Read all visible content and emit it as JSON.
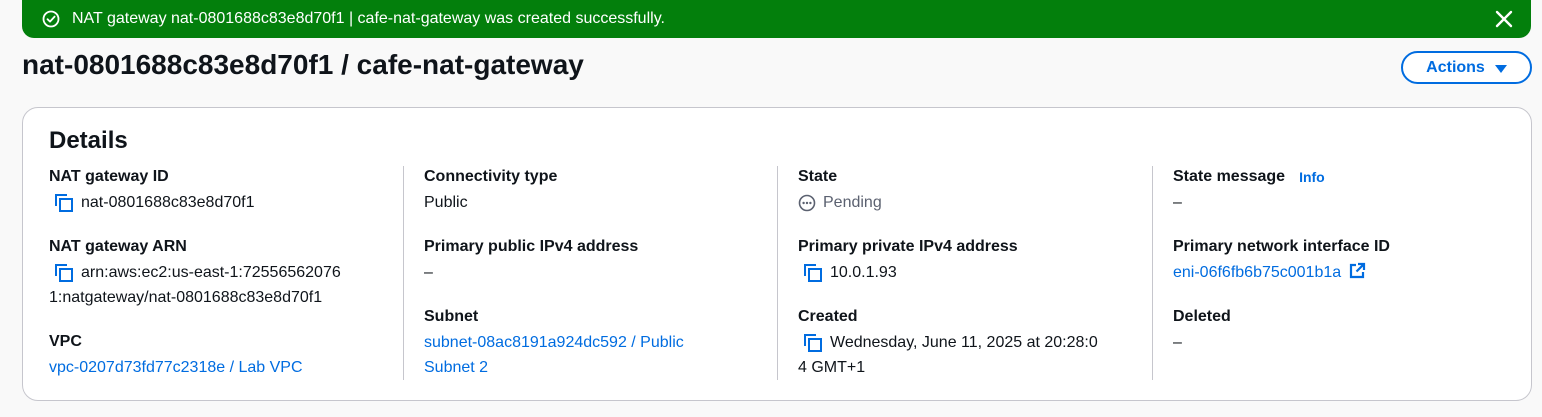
{
  "flash": {
    "message": "NAT gateway nat-0801688c83e8d70f1 | cafe-nat-gateway was created successfully.",
    "icon": "check-circle-icon",
    "dismiss_icon": "close-icon",
    "color": "#037f0c"
  },
  "header": {
    "title": "nat-0801688c83e8d70f1 / cafe-nat-gateway",
    "actions_label": "Actions"
  },
  "details": {
    "title": "Details",
    "nat_gateway_id": {
      "label": "NAT gateway ID",
      "value": "nat-0801688c83e8d70f1"
    },
    "nat_gateway_arn": {
      "label": "NAT gateway ARN",
      "value_line1": "arn:aws:ec2:us-east-1:72556562076",
      "value_line2": "1:natgateway/nat-0801688c83e8d70f1"
    },
    "vpc": {
      "label": "VPC",
      "value": "vpc-0207d73fd77c2318e / Lab VPC"
    },
    "connectivity_type": {
      "label": "Connectivity type",
      "value": "Public"
    },
    "primary_public_ipv4": {
      "label": "Primary public IPv4 address",
      "value": "–"
    },
    "subnet": {
      "label": "Subnet",
      "value_line1": "subnet-08ac8191a924dc592 / Public",
      "value_line2": "Subnet 2"
    },
    "state": {
      "label": "State",
      "value": "Pending"
    },
    "primary_private_ipv4": {
      "label": "Primary private IPv4 address",
      "value": "10.0.1.93"
    },
    "created": {
      "label": "Created",
      "value_line1": "Wednesday, June 11, 2025 at 20:28:0",
      "value_line2": "4 GMT+1"
    },
    "state_message": {
      "label": "State message",
      "info": "Info",
      "value": "–"
    },
    "primary_network_interface": {
      "label": "Primary network interface ID",
      "value": "eni-06f6fb6b75c001b1a"
    },
    "deleted": {
      "label": "Deleted",
      "value": "–"
    }
  },
  "colors": {
    "link": "#006ce0",
    "success": "#037f0c",
    "border": "#c6c6cd"
  }
}
